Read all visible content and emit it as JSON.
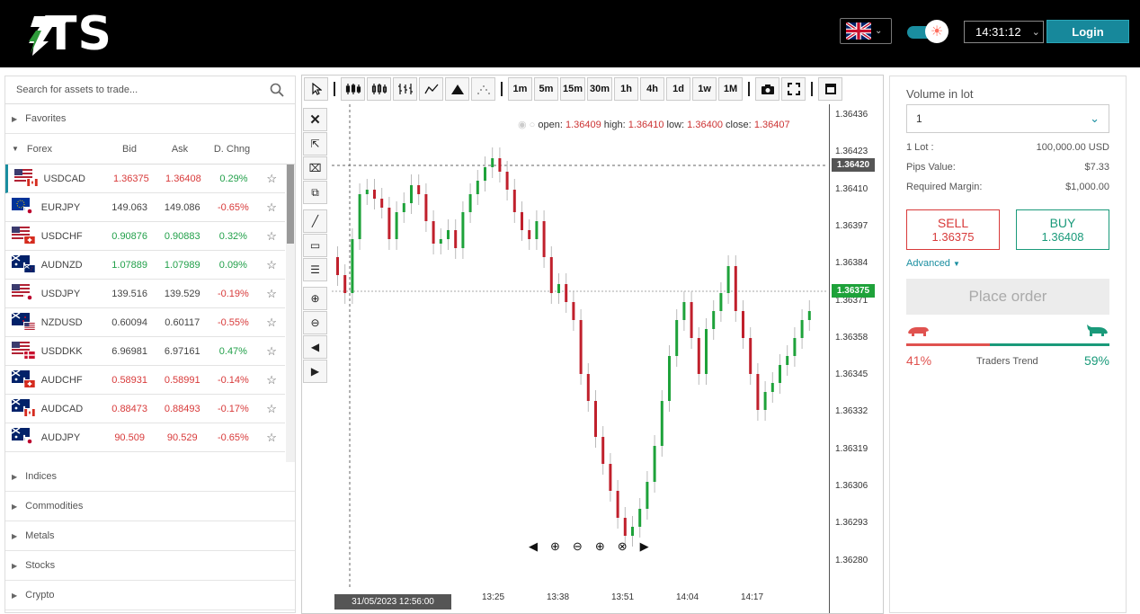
{
  "header": {
    "logo_text": "TS",
    "time": "14:31:12",
    "login_label": "Login",
    "language_flag": "uk-flag-icon"
  },
  "sidebar": {
    "search_placeholder": "Search for assets to trade...",
    "favorites_label": "Favorites",
    "forex_label": "Forex",
    "col_bid": "Bid",
    "col_ask": "Ask",
    "col_chng": "D. Chng",
    "rows": [
      {
        "symbol": "USDCAD",
        "bid": "1.36375",
        "ask": "1.36408",
        "chng": "0.29%",
        "bid_color": "red",
        "ask_color": "red",
        "chng_color": "green",
        "flags": [
          "us",
          "ca"
        ]
      },
      {
        "symbol": "EURJPY",
        "bid": "149.063",
        "ask": "149.086",
        "chng": "-0.65%",
        "bid_color": "dark",
        "ask_color": "dark",
        "chng_color": "red",
        "flags": [
          "eu",
          "jp"
        ]
      },
      {
        "symbol": "USDCHF",
        "bid": "0.90876",
        "ask": "0.90883",
        "chng": "0.32%",
        "bid_color": "green",
        "ask_color": "green",
        "chng_color": "green",
        "flags": [
          "us",
          "ch"
        ]
      },
      {
        "symbol": "AUDNZD",
        "bid": "1.07889",
        "ask": "1.07989",
        "chng": "0.09%",
        "bid_color": "green",
        "ask_color": "green",
        "chng_color": "green",
        "flags": [
          "au",
          "nz"
        ]
      },
      {
        "symbol": "USDJPY",
        "bid": "139.516",
        "ask": "139.529",
        "chng": "-0.19%",
        "bid_color": "dark",
        "ask_color": "dark",
        "chng_color": "red",
        "flags": [
          "us",
          "jp"
        ]
      },
      {
        "symbol": "NZDUSD",
        "bid": "0.60094",
        "ask": "0.60117",
        "chng": "-0.55%",
        "bid_color": "dark",
        "ask_color": "dark",
        "chng_color": "red",
        "flags": [
          "nz",
          "us"
        ]
      },
      {
        "symbol": "USDDKK",
        "bid": "6.96981",
        "ask": "6.97161",
        "chng": "0.47%",
        "bid_color": "dark",
        "ask_color": "dark",
        "chng_color": "green",
        "flags": [
          "us",
          "dk"
        ]
      },
      {
        "symbol": "AUDCHF",
        "bid": "0.58931",
        "ask": "0.58991",
        "chng": "-0.14%",
        "bid_color": "red",
        "ask_color": "red",
        "chng_color": "red",
        "flags": [
          "au",
          "ch"
        ]
      },
      {
        "symbol": "AUDCAD",
        "bid": "0.88473",
        "ask": "0.88493",
        "chng": "-0.17%",
        "bid_color": "red",
        "ask_color": "red",
        "chng_color": "red",
        "flags": [
          "au",
          "ca"
        ]
      },
      {
        "symbol": "AUDJPY",
        "bid": "90.509",
        "ask": "90.529",
        "chng": "-0.65%",
        "bid_color": "red",
        "ask_color": "red",
        "chng_color": "red",
        "flags": [
          "au",
          "jp"
        ]
      }
    ],
    "categories": [
      "Indices",
      "Commodities",
      "Metals",
      "Stocks",
      "Crypto"
    ]
  },
  "chart": {
    "timeframes": [
      "1m",
      "5m",
      "15m",
      "30m",
      "1h",
      "4h",
      "1d",
      "1w",
      "1M"
    ],
    "ohlc_open_label": "open:",
    "ohlc_open": "1.36409",
    "ohlc_high_label": "high:",
    "ohlc_high": "1.36410",
    "ohlc_low_label": "low:",
    "ohlc_low": "1.36400",
    "ohlc_close_label": "close:",
    "ohlc_close": "1.36407",
    "price_labels": [
      "1.36436",
      "1.36423",
      "1.36410",
      "1.36397",
      "1.36384",
      "1.36371",
      "1.36358",
      "1.36345",
      "1.36332",
      "1.36319",
      "1.36306",
      "1.36293",
      "1.36280"
    ],
    "crosshair_price": "1.36420",
    "current_price": "1.36375",
    "time_labels": [
      "13:25",
      "13:38",
      "13:51",
      "14:04",
      "14:17"
    ],
    "crosshair_date": "31/05/2023 12:56:00"
  },
  "order": {
    "volume_label": "Volume in lot",
    "volume_value": "1",
    "lot_label": "1 Lot :",
    "lot_value": "100,000.00 USD",
    "pips_label": "Pips Value:",
    "pips_value": "$7.33",
    "margin_label": "Required Margin:",
    "margin_value": "$1,000.00",
    "sell_label": "SELL",
    "sell_price": "1.36375",
    "buy_label": "BUY",
    "buy_price": "1.36408",
    "advanced_label": "Advanced",
    "place_order_label": "Place order",
    "sell_pct": "41%",
    "buy_pct": "59%",
    "sell_fraction": 0.41,
    "trend_label": "Traders Trend"
  }
}
